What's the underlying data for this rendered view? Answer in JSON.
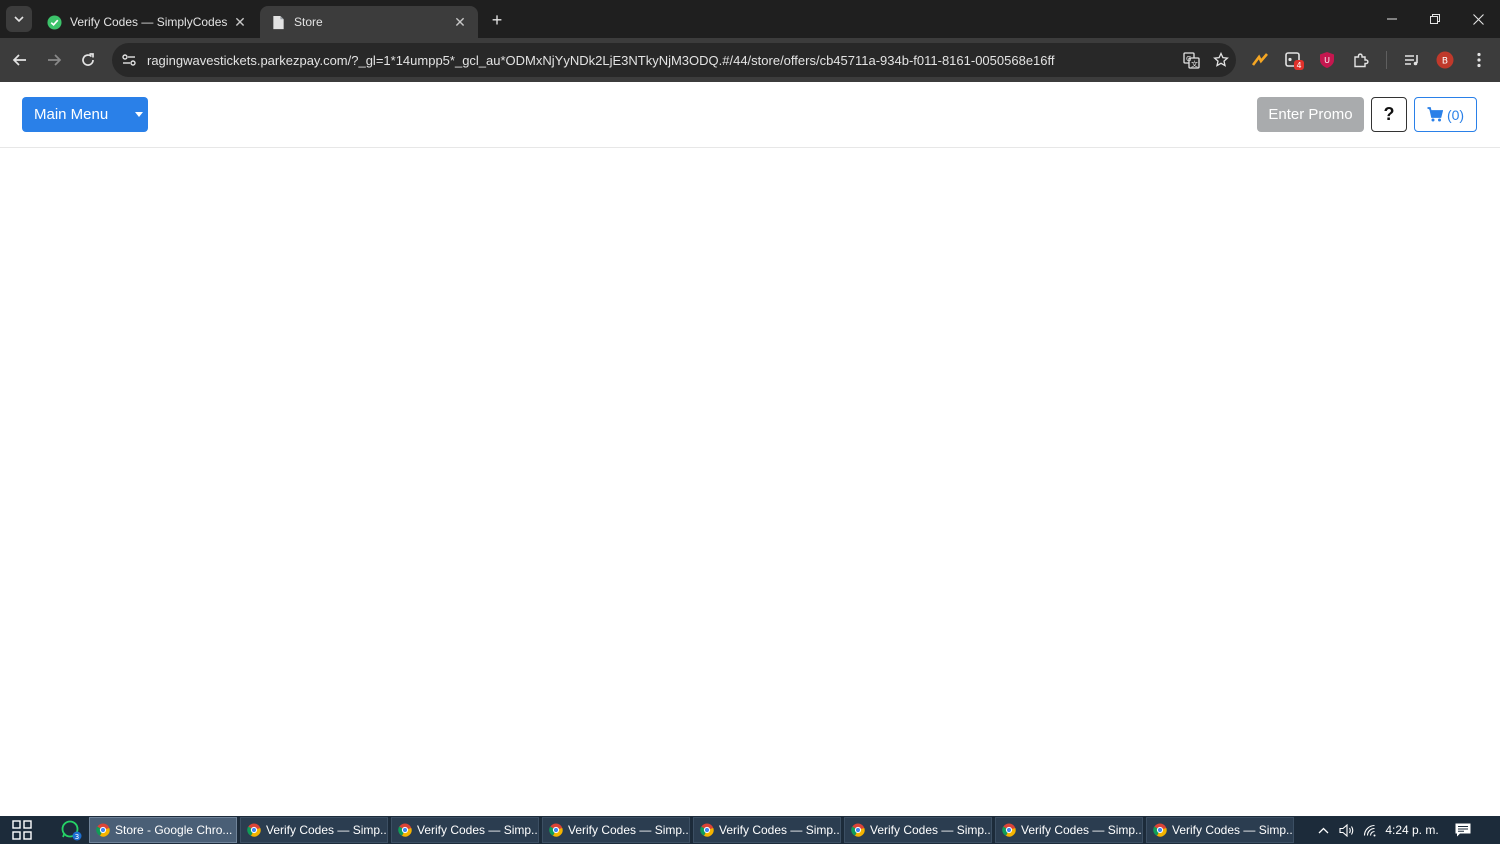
{
  "browser": {
    "tabs": [
      {
        "title": "Verify Codes — SimplyCodes",
        "favicon": "simplycodes-icon",
        "active": false
      },
      {
        "title": "Store",
        "favicon": "page-icon",
        "active": true
      }
    ],
    "url": "ragingwavestickets.parkezpay.com/?_gl=1*14umpp5*_gcl_au*ODMxNjYyNDk2LjE3NTkyNjM3ODQ.#/44/store/offers/cb45711a-934b-f011-8161-0050568e16ff",
    "extension_badge": "4",
    "profile_initial": "B"
  },
  "store": {
    "main_menu_label": "Main Menu",
    "promo_label": "Enter Promo",
    "help_label": "?",
    "cart_label": "(0)",
    "accent_color": "#2a80e8"
  },
  "taskbar": {
    "whatsapp_badge": "3",
    "items": [
      {
        "label": "Store - Google Chro...",
        "active": true
      },
      {
        "label": "Verify Codes — Simp...",
        "active": false
      },
      {
        "label": "Verify Codes — Simp...",
        "active": false
      },
      {
        "label": "Verify Codes — Simp...",
        "active": false
      },
      {
        "label": "Verify Codes — Simp...",
        "active": false
      },
      {
        "label": "Verify Codes — Simp...",
        "active": false
      },
      {
        "label": "Verify Codes — Simp...",
        "active": false
      },
      {
        "label": "Verify Codes — Simp...",
        "active": false
      }
    ],
    "clock": "4:24 p. m."
  }
}
